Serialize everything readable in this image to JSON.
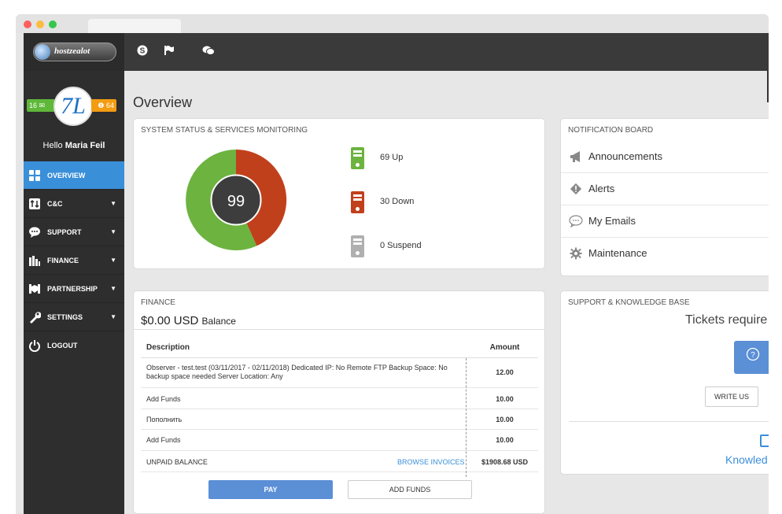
{
  "header": {
    "logo_text": "hostzealot",
    "icons": [
      "skype-icon",
      "flag-icon",
      "chat-icon"
    ]
  },
  "sidebar": {
    "mail_count": "16",
    "alert_count": "64",
    "avatar_text": "7L",
    "hello_prefix": "Hello",
    "user_name": "Maria Feil",
    "items": [
      {
        "label": "OVERVIEW",
        "icon": "grid-icon",
        "active": true
      },
      {
        "label": "C&C",
        "icon": "arrows-icon",
        "caret": "▼"
      },
      {
        "label": "SUPPORT",
        "icon": "chat-bubble-icon",
        "caret": "▼"
      },
      {
        "label": "FINANCE",
        "icon": "coins-icon",
        "caret": "▼"
      },
      {
        "label": "PARTNERSHIP",
        "icon": "handshake-icon",
        "caret": "▼"
      },
      {
        "label": "SETTINGS",
        "icon": "wrench-icon",
        "caret": "▼"
      },
      {
        "label": "LOGOUT",
        "icon": "power-icon"
      }
    ]
  },
  "main": {
    "title": "Overview",
    "system_status": {
      "title": "SYSTEM STATUS & SERVICES MONITORING",
      "total": "99",
      "up_label": "69 Up",
      "down_label": "30 Down",
      "suspend_label": "0 Suspend"
    },
    "notification_board": {
      "title": "NOTIFICATION BOARD",
      "items": [
        {
          "label": "Announcements",
          "icon": "megaphone-icon"
        },
        {
          "label": "Alerts",
          "icon": "alert-icon"
        },
        {
          "label": "My Emails",
          "icon": "speech-icon"
        },
        {
          "label": "Maintenance",
          "icon": "gear-icon"
        }
      ]
    },
    "finance": {
      "title": "FINANCE",
      "balance_amount": "$0.00 USD",
      "balance_label": "Balance",
      "col_description": "Description",
      "col_amount": "Amount",
      "rows": [
        {
          "description": "Observer - test.test (03/11/2017 - 02/11/2018) Dedicated IP: No Remote FTP Backup Space: No backup space needed Server Location: Any",
          "amount": "12.00"
        },
        {
          "description": "Add Funds",
          "amount": "10.00"
        },
        {
          "description": "Пополнить",
          "amount": "10.00"
        },
        {
          "description": "Add Funds",
          "amount": "10.00"
        }
      ],
      "unpaid_label": "UNPAID BALANCE",
      "browse_invoices": "BROWSE INVOICES",
      "unpaid_amount": "$1908.68 USD",
      "pay_button": "PAY",
      "add_funds_button": "ADD FUNDS"
    },
    "support": {
      "title": "SUPPORT & KNOWLEDGE BASE",
      "tickets_text": "Tickets require",
      "write_us": "WRITE US",
      "knowledge_text": "Knowled"
    }
  },
  "colors": {
    "accent": "#3a8fd9",
    "up": "#6cb33f",
    "down": "#c1401c",
    "suspend": "#b0b0b0"
  }
}
